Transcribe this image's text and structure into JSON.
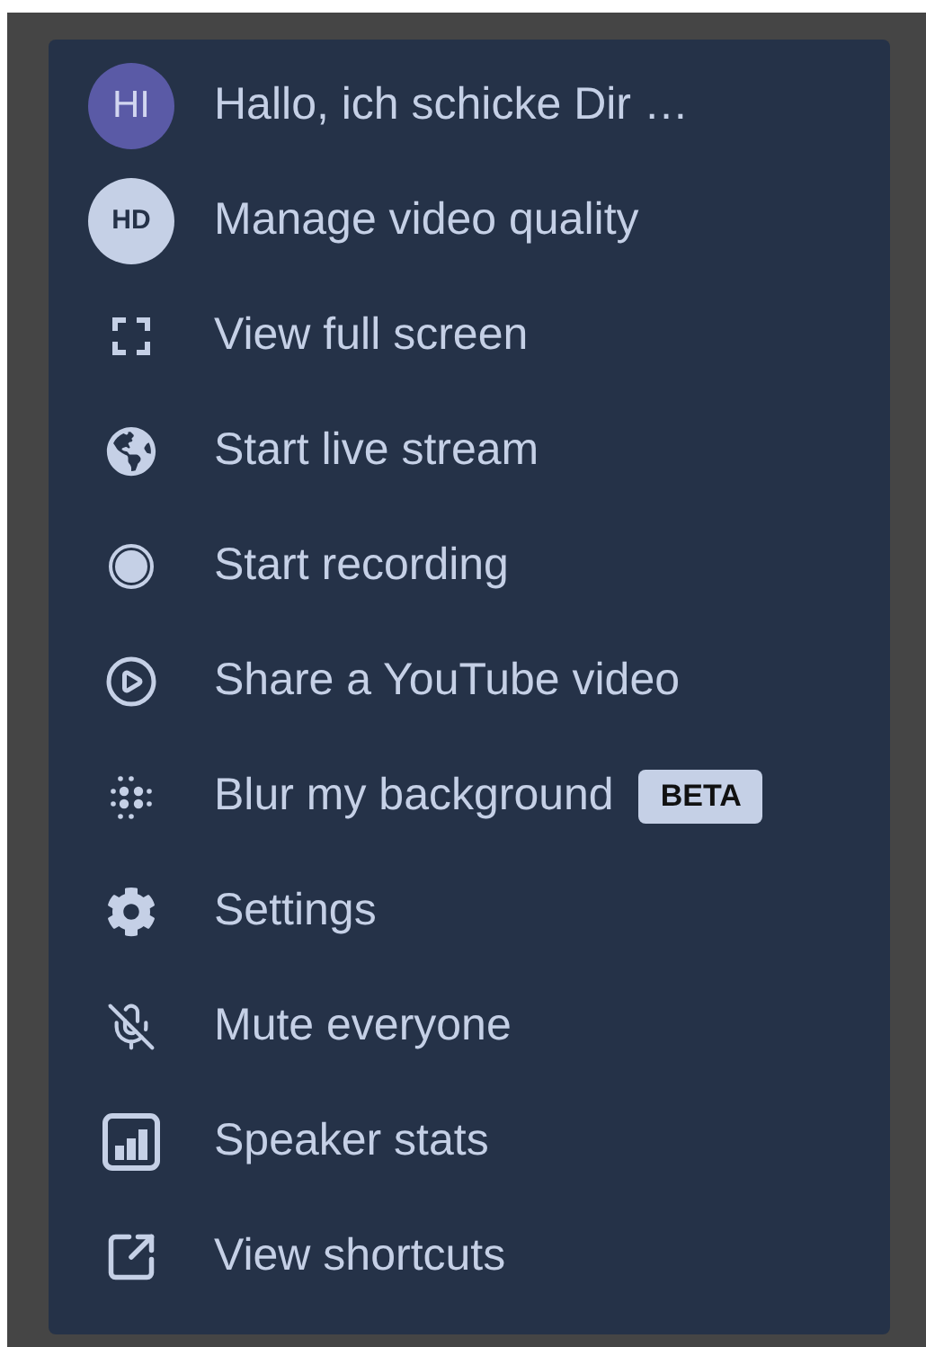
{
  "menu": {
    "items": [
      {
        "kind": "avatar",
        "initials": "HI",
        "label": "Hallo, ich schicke Dir …"
      },
      {
        "kind": "badge",
        "initials": "HD",
        "label": "Manage video quality"
      },
      {
        "kind": "icon",
        "label": "View full screen"
      },
      {
        "kind": "icon",
        "label": "Start live stream"
      },
      {
        "kind": "icon",
        "label": "Start recording"
      },
      {
        "kind": "icon",
        "label": "Share a YouTube video"
      },
      {
        "kind": "icon",
        "label": "Blur my background",
        "tag": "BETA"
      },
      {
        "kind": "icon",
        "label": "Settings"
      },
      {
        "kind": "icon",
        "label": "Mute everyone"
      },
      {
        "kind": "icon",
        "label": "Speaker stats"
      },
      {
        "kind": "icon",
        "label": "View shortcuts"
      }
    ]
  }
}
